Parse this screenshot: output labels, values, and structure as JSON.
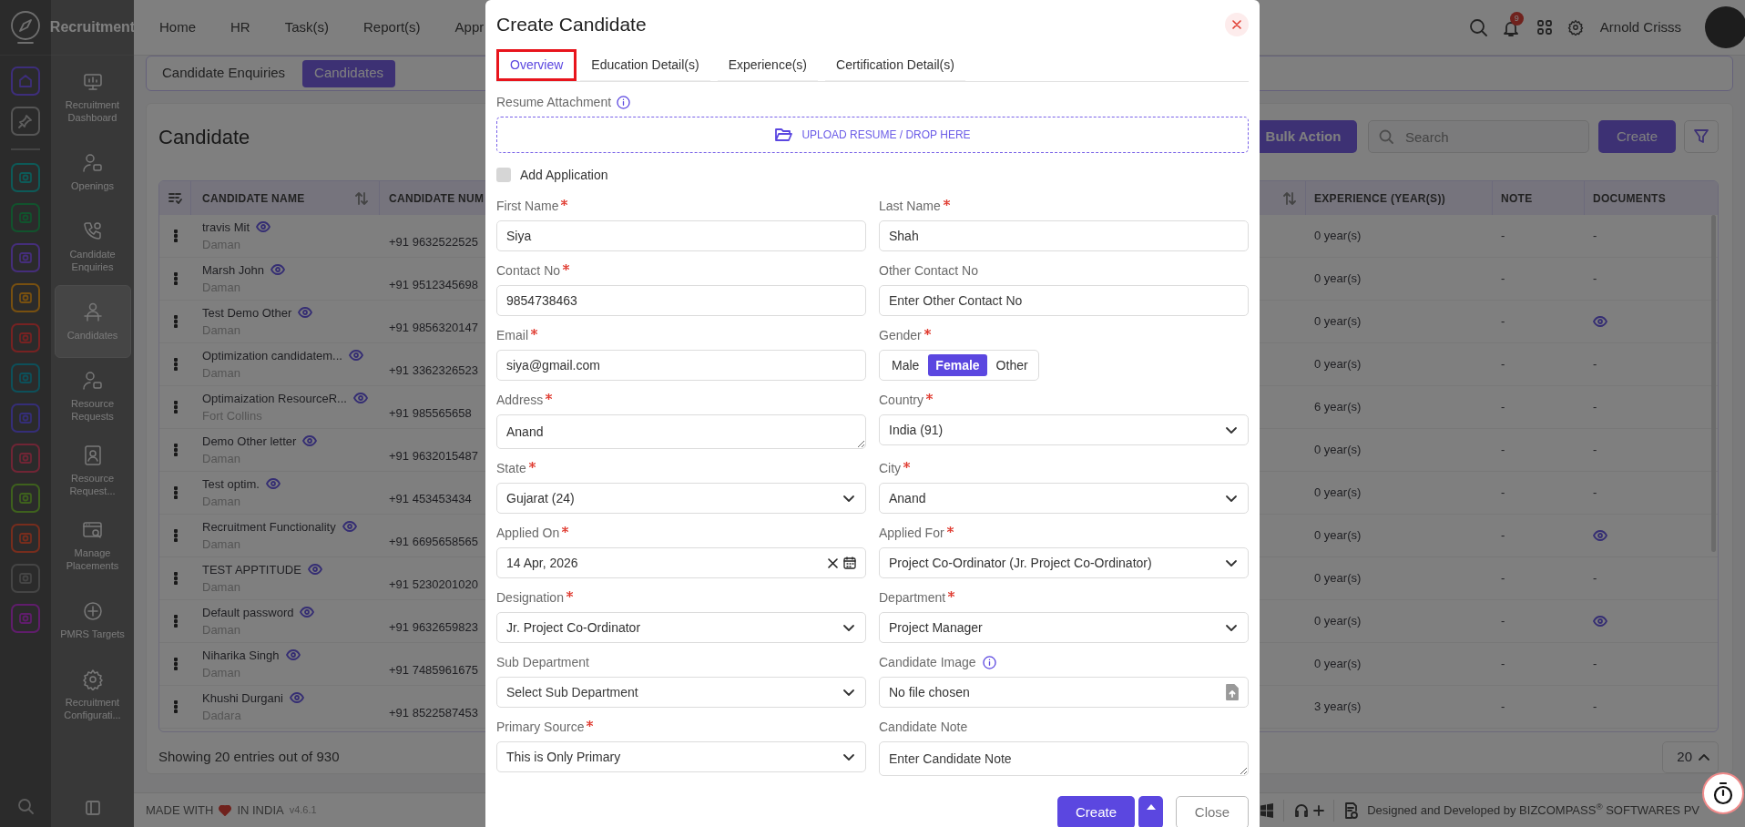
{
  "app": {
    "name": "Recruitment"
  },
  "top_menu": [
    "Home",
    "HR",
    "Task(s)",
    "Report(s)",
    "Appr"
  ],
  "notifications": {
    "count": "9"
  },
  "user": {
    "name": "Arnold Crisss"
  },
  "sidebar": {
    "items": [
      {
        "label": "Recruitment Dashboard",
        "selected": false
      },
      {
        "label": "Openings",
        "selected": false
      },
      {
        "label": "Candidate Enquiries",
        "selected": false
      },
      {
        "label": "Candidates",
        "selected": true
      },
      {
        "label": "Resource Requests",
        "selected": false
      },
      {
        "label": "Resource Request...",
        "selected": false
      },
      {
        "label": "Manage Placements",
        "selected": false
      },
      {
        "label": "PMRS Targets",
        "selected": false
      },
      {
        "label": "Recruitment Configurati...",
        "selected": false
      }
    ]
  },
  "page_tabs": [
    {
      "label": "Candidate Enquiries",
      "selected": false
    },
    {
      "label": "Candidates",
      "selected": true
    }
  ],
  "card": {
    "title": "Candidate",
    "bulk_action": "Bulk Action",
    "search": {
      "placeholder": "Search"
    },
    "create": "Create"
  },
  "table": {
    "columns": [
      "CANDIDATE NAME",
      "CANDIDATE NUM",
      "EXPERIENCE (YEAR(S))",
      "NOTE",
      "DOCUMENTS"
    ],
    "rows": [
      {
        "name": "travis Mit",
        "location": "Daman",
        "number": "+91 9632522525",
        "experience": "0 year(s)",
        "note": "-",
        "documents": {
          "kind": "text",
          "text": "-"
        }
      },
      {
        "name": "Marsh John",
        "location": "Daman",
        "number": "+91 9512345698",
        "experience": "0 year(s)",
        "note": "-",
        "documents": {
          "kind": "text",
          "text": "-"
        }
      },
      {
        "name": "Test Demo Other",
        "location": "Daman",
        "number": "+91 9856320147",
        "experience": "0 year(s)",
        "note": "-",
        "documents": {
          "kind": "view"
        }
      },
      {
        "name": "Optimization candidatem...",
        "location": "Daman",
        "number": "+91 3362326523",
        "experience": "0 year(s)",
        "note": "-",
        "documents": {
          "kind": "text",
          "text": "-"
        }
      },
      {
        "name": "Optimaization ResourceR...",
        "location": "Fort Collins",
        "number": "+91 985565658",
        "experience": "6 year(s)",
        "note": "-",
        "documents": {
          "kind": "text",
          "text": "-"
        }
      },
      {
        "name": "Demo Other letter",
        "location": "Daman",
        "number": "+91 9632015487",
        "experience": "0 year(s)",
        "note": "-",
        "documents": {
          "kind": "text",
          "text": "-"
        }
      },
      {
        "name": "Test optim.",
        "location": "Daman",
        "number": "+91 453453434",
        "experience": "0 year(s)",
        "note": "-",
        "documents": {
          "kind": "text",
          "text": "-"
        }
      },
      {
        "name": "Recruitment Functionality",
        "location": "Daman",
        "number": "+91 6695658565",
        "experience": "0 year(s)",
        "note": "-",
        "documents": {
          "kind": "view"
        }
      },
      {
        "name": "TEST APPTITUDE",
        "location": "Daman",
        "number": "+91 5230201020",
        "experience": "0 year(s)",
        "note": "-",
        "documents": {
          "kind": "text",
          "text": "-"
        }
      },
      {
        "name": "Default password",
        "location": "Daman",
        "number": "+91 9632659823",
        "experience": "0 year(s)",
        "note": "-",
        "documents": {
          "kind": "view"
        }
      },
      {
        "name": "Niharika Singh",
        "location": "Daman",
        "number": "+91 7485961675",
        "experience": "0 year(s)",
        "note": "-",
        "documents": {
          "kind": "text",
          "text": "-"
        }
      },
      {
        "name": "Khushi Durgani",
        "location": "Dadara",
        "number": "+91 8522587453",
        "experience": "3 year(s)",
        "note": "-",
        "documents": {
          "kind": "text",
          "text": "-"
        }
      }
    ]
  },
  "pagination": {
    "summary": "Showing 20 entries out of 930",
    "page_size": "20"
  },
  "footer": {
    "made_with": "MADE WITH",
    "in_india": "IN INDIA",
    "version": "v4.6.1",
    "credit": "Designed and Developed by  BIZCOMPASS$^{®}$ SOFTWARES PV"
  },
  "modal": {
    "title": "Create Candidate",
    "tabs": [
      {
        "label": "Overview",
        "selected": true
      },
      {
        "label": "Education Detail(s)",
        "selected": false
      },
      {
        "label": "Experience(s)",
        "selected": false
      },
      {
        "label": "Certification Detail(s)",
        "selected": false
      }
    ],
    "resume": {
      "label": "Resume Attachment",
      "upload": "UPLOAD RESUME / DROP HERE"
    },
    "add_application": {
      "label": "Add Application",
      "checked": false
    },
    "fields": [
      {
        "kind": "text",
        "label": "First Name",
        "required": true,
        "value": "Siya"
      },
      {
        "kind": "text",
        "label": "Last Name",
        "required": true,
        "value": "Shah"
      },
      {
        "kind": "text",
        "label": "Contact No",
        "required": true,
        "value": "9854738463"
      },
      {
        "kind": "text",
        "label": "Other Contact No",
        "required": false,
        "placeholder": "Enter Other Contact No"
      },
      {
        "kind": "text",
        "label": "Email",
        "required": true,
        "value": "siya@gmail.com"
      },
      {
        "kind": "segmented",
        "label": "Gender",
        "required": true,
        "options": [
          {
            "label": "Male",
            "selected": false
          },
          {
            "label": "Female",
            "selected": true
          },
          {
            "label": "Other",
            "selected": false
          }
        ]
      },
      {
        "kind": "textarea",
        "label": "Address",
        "required": true,
        "value": "Anand"
      },
      {
        "kind": "select",
        "label": "Country",
        "required": true,
        "value": "India (91)"
      },
      {
        "kind": "select",
        "label": "State",
        "required": true,
        "value": "Gujarat (24)"
      },
      {
        "kind": "select",
        "label": "City",
        "required": true,
        "value": "Anand"
      },
      {
        "kind": "date",
        "label": "Applied On",
        "required": true,
        "value": "14 Apr, 2026"
      },
      {
        "kind": "select",
        "label": "Applied For",
        "required": true,
        "value": "Project Co-Ordinator (Jr. Project Co-Ordinator)"
      },
      {
        "kind": "select",
        "label": "Designation",
        "required": true,
        "value": "Jr. Project Co-Ordinator"
      },
      {
        "kind": "select",
        "label": "Department",
        "required": true,
        "value": "Project Manager"
      },
      {
        "kind": "select",
        "label": "Sub Department",
        "required": false,
        "placeholder": "Select Sub Department"
      },
      {
        "kind": "file",
        "label": "Candidate Image",
        "required": false,
        "info": true,
        "value": "No file chosen"
      },
      {
        "kind": "select",
        "label": "Primary Source",
        "required": true,
        "value": "This is Only Primary"
      },
      {
        "kind": "textarea",
        "label": "Candidate Note",
        "required": false,
        "placeholder": "Enter Candidate Note"
      }
    ],
    "buttons": {
      "create": "Create",
      "close": "Close"
    }
  }
}
